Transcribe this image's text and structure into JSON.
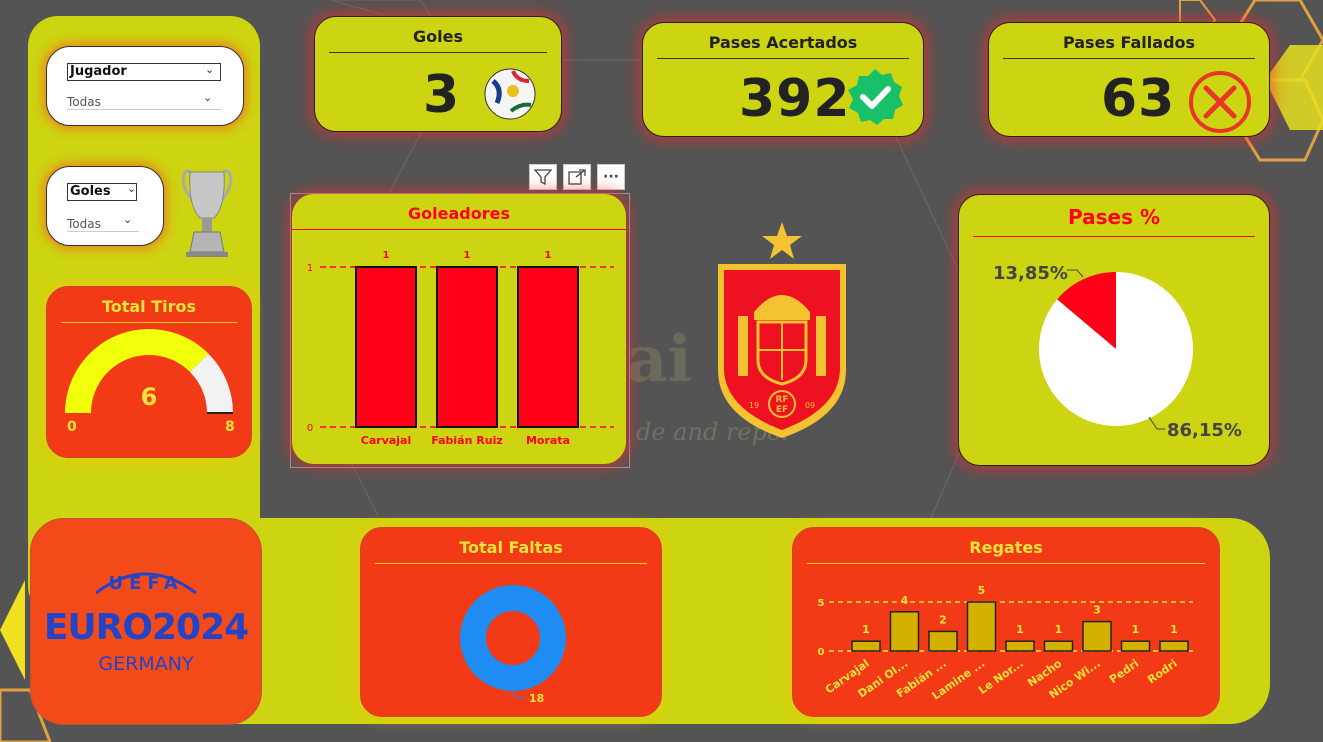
{
  "slicers": {
    "jugador": {
      "label": "Jugador",
      "value": "Todas"
    },
    "goles": {
      "label": "Goles",
      "value": "Todas"
    }
  },
  "kpis": {
    "goles": {
      "title": "Goles",
      "value": "3"
    },
    "pases_acertados": {
      "title": "Pases Acertados",
      "value": "392"
    },
    "pases_fallados": {
      "title": "Pases Fallados",
      "value": "63"
    }
  },
  "total_tiros": {
    "title": "Total Tiros",
    "value": "6",
    "min": "0",
    "max": "8",
    "fraction": 0.75
  },
  "watermark": {
    "main": "a Sa  ai",
    "sub": "de and repor"
  },
  "logo": {
    "line1": "UEFA",
    "line2": "EURO2024",
    "line3": "GERMANY"
  },
  "crest": {
    "badge1": "RF",
    "badge2": "EF",
    "year_left": "19",
    "year_right": "09"
  },
  "colors": {
    "panel": "#cdd411",
    "red": "#ff0018",
    "orange": "#f23a16",
    "blue": "#1e8cf2",
    "gold": "#d4b000"
  },
  "chart_data": [
    {
      "type": "bar",
      "title": "Goleadores",
      "categories": [
        "Carvajal",
        "Fabián Ruiz",
        "Morata"
      ],
      "values": [
        1,
        1,
        1
      ],
      "data_labels": [
        "1",
        "1",
        "1"
      ],
      "ylim": [
        0,
        1
      ],
      "yticks": [
        "0",
        "1"
      ],
      "grid": true
    },
    {
      "type": "pie",
      "title": "Pases %",
      "slices": [
        {
          "label": "13,85%",
          "value": 13.85,
          "color": "#ff0018"
        },
        {
          "label": "86,15%",
          "value": 86.15,
          "color": "#ffffff"
        }
      ]
    },
    {
      "type": "pie",
      "title": "Total Faltas",
      "donut": true,
      "slices": [
        {
          "label": "18",
          "value": 18,
          "color": "#1e8cf2"
        }
      ]
    },
    {
      "type": "bar",
      "title": "Regates",
      "categories": [
        "Carvajal",
        "Dani Ol...",
        "Fabián ...",
        "Lamine ...",
        "Le Nor...",
        "Nacho",
        "Nico Wi...",
        "Pedri",
        "Rodri"
      ],
      "values": [
        1,
        4,
        2,
        5,
        1,
        1,
        3,
        1,
        1
      ],
      "data_labels": [
        "1",
        "4",
        "2",
        "5",
        "1",
        "1",
        "3",
        "1",
        "1"
      ],
      "ylim": [
        0,
        5
      ],
      "yticks": [
        "0",
        "5"
      ],
      "grid": true
    }
  ],
  "toolbar": {
    "filter_icon": "filter-icon",
    "focus_icon": "focus-mode-icon",
    "more_icon": "more-options-icon",
    "more_label": "···"
  }
}
